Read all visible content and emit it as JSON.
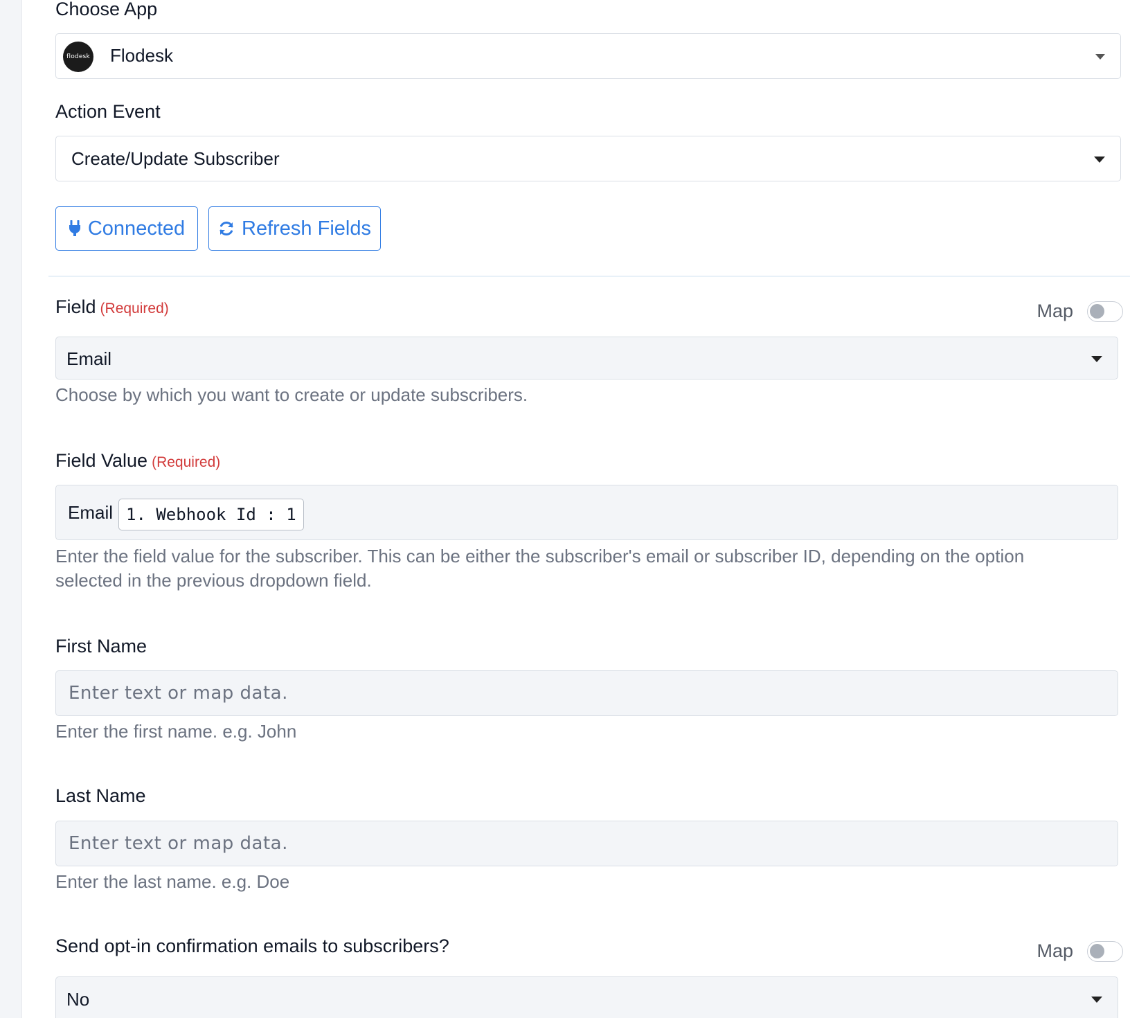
{
  "choose_app": {
    "label": "Choose App",
    "logo_text": "flodesk",
    "value": "Flodesk"
  },
  "action_event": {
    "label": "Action Event",
    "value": "Create/Update Subscriber"
  },
  "buttons": {
    "connected": "Connected",
    "refresh": "Refresh Fields"
  },
  "field": {
    "label": "Field",
    "required": "(Required)",
    "map_label": "Map",
    "value": "Email",
    "help": "Choose by which you want to create or update subscribers."
  },
  "field_value": {
    "label": "Field Value",
    "required": "(Required)",
    "text": "Email",
    "chip": "1. Webhook Id : 1",
    "help_line1": "Enter the field value for the subscriber. This can be either the subscriber's email or subscriber ID, depending on the option",
    "help_line2": "selected in the previous dropdown field."
  },
  "first_name": {
    "label": "First Name",
    "placeholder": "Enter text or map data.",
    "help": "Enter the first name. e.g. John"
  },
  "last_name": {
    "label": "Last Name",
    "placeholder": "Enter text or map data.",
    "help": "Enter the last name. e.g. Doe"
  },
  "opt_in": {
    "label": "Send opt-in confirmation emails to subscribers?",
    "map_label": "Map",
    "value": "No"
  },
  "colors": {
    "accent": "#2f7be3",
    "required": "#d23b3b",
    "field_bg": "#f3f5f8"
  }
}
